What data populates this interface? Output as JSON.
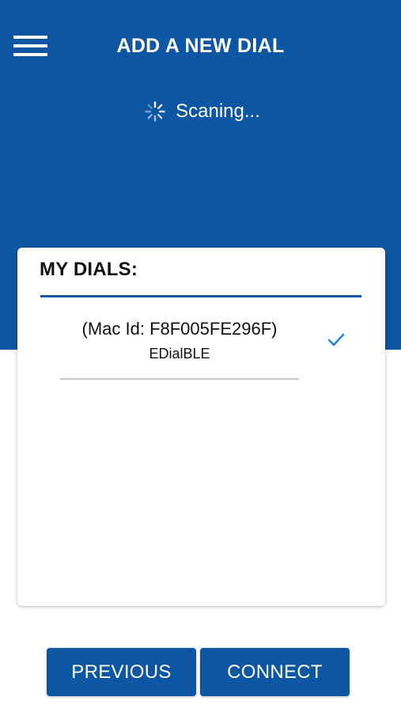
{
  "header": {
    "title": "ADD A NEW DIAL",
    "scan_status": "Scaning...",
    "menu_icon": "hamburger-menu-icon",
    "spinner_icon": "loading-spinner-icon"
  },
  "dials_card": {
    "title": "MY DIALS:",
    "items": [
      {
        "mac_label": "(Mac Id: F8F005FE296F)",
        "name": "EDialBLE",
        "selected": true,
        "check_icon": "checkmark-icon"
      }
    ]
  },
  "footer": {
    "previous_label": "PREVIOUS",
    "connect_label": "CONNECT"
  },
  "colors": {
    "primary": "#0d56a4",
    "background": "#ffffff",
    "divider": "#c9c9c9",
    "check": "#1e88e5"
  }
}
